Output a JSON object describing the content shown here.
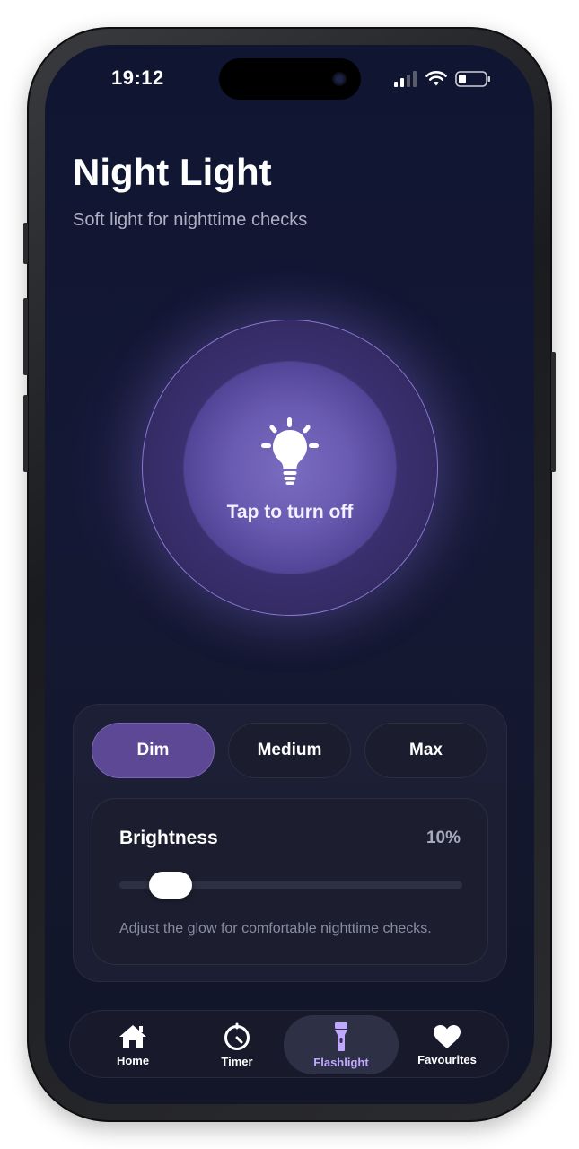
{
  "status_bar": {
    "time": "19:12"
  },
  "header": {
    "title": "Night Light",
    "subtitle": "Soft light for nighttime checks"
  },
  "light_button": {
    "label": "Tap to turn off",
    "icon": "lightbulb-icon"
  },
  "modes": [
    {
      "label": "Dim",
      "active": true
    },
    {
      "label": "Medium",
      "active": false
    },
    {
      "label": "Max",
      "active": false
    }
  ],
  "brightness": {
    "label": "Brightness",
    "value_text": "10%",
    "value": 10,
    "hint": "Adjust the glow for comfortable nighttime checks."
  },
  "tabbar": {
    "items": [
      {
        "label": "Home",
        "icon": "home-icon",
        "active": false
      },
      {
        "label": "Timer",
        "icon": "timer-icon",
        "active": false
      },
      {
        "label": "Flashlight",
        "icon": "flashlight-icon",
        "active": true
      },
      {
        "label": "Favourites",
        "icon": "heart-icon",
        "active": false
      }
    ]
  },
  "colors": {
    "background": "#121630",
    "accent": "#5c4895",
    "active_tab_text": "#c0a8ff",
    "light_core": "#7a6cc0"
  }
}
